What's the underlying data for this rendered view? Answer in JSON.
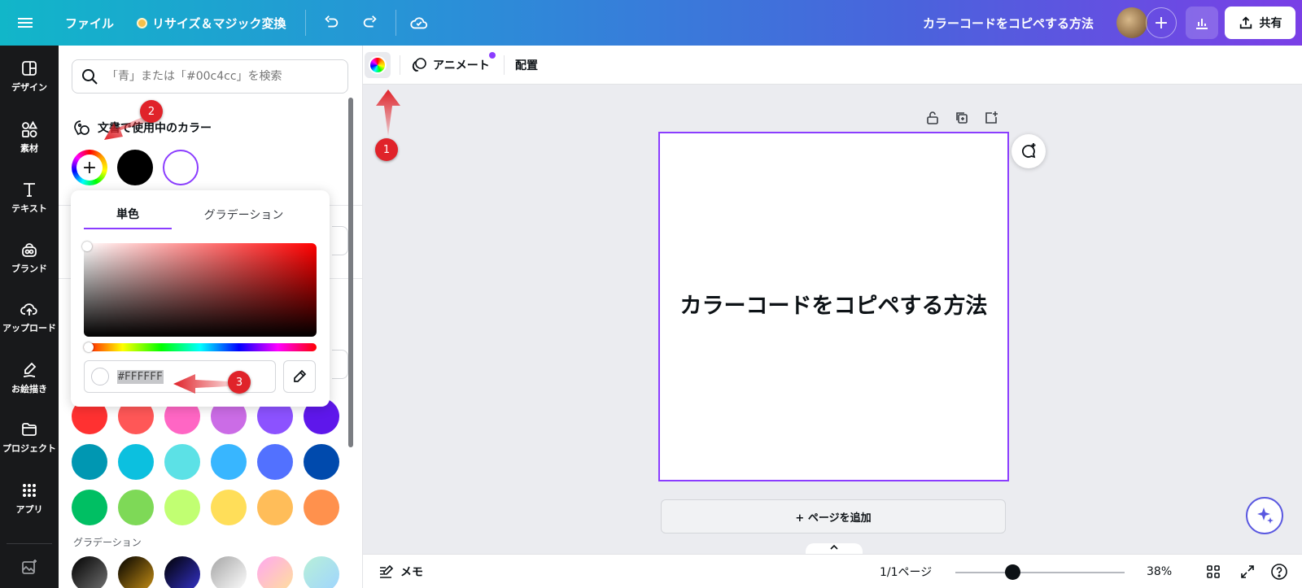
{
  "topbar": {
    "file_label": "ファイル",
    "resize_label": "リサイズ＆マジック変換",
    "doc_title": "カラーコードをコピペする方法",
    "add_label": "+",
    "share_label": "共有"
  },
  "rail": {
    "items": [
      {
        "label": "デザイン"
      },
      {
        "label": "素材"
      },
      {
        "label": "テキスト"
      },
      {
        "label": "ブランド"
      },
      {
        "label": "アップロード"
      },
      {
        "label": "お絵描き"
      },
      {
        "label": "プロジェクト"
      },
      {
        "label": "アプリ"
      }
    ]
  },
  "panel": {
    "search_placeholder": "「青」または「#00c4cc」を検索",
    "used_colors_title": "文書で使用中のカラー",
    "add_symbol": "+",
    "gradient_label": "グラデーション",
    "used_colors": [
      "#000000",
      "#FFFFFF"
    ],
    "palette": [
      "#ff3131",
      "#ff5757",
      "#ff66c4",
      "#cb6ce6",
      "#8c52ff",
      "#5e17eb",
      "#0097b2",
      "#0cc0df",
      "#5ce1e6",
      "#38b6ff",
      "#5271ff",
      "#004aad",
      "#00bf63",
      "#7ed957",
      "#c1ff72",
      "#ffde59",
      "#ffbd59",
      "#ff914d"
    ]
  },
  "picker": {
    "tab_solid": "単色",
    "tab_gradient": "グラデーション",
    "hex_value": "#FFFFFF",
    "accent": "#8b3dff"
  },
  "toolbar": {
    "animate_label": "アニメート",
    "arrange_label": "配置"
  },
  "canvas": {
    "page_text": "カラーコードをコピペする方法",
    "add_page_label": "+ ページを追加"
  },
  "bottombar": {
    "notes_label": "メモ",
    "page_indicator": "1/1ページ",
    "zoom": "38%",
    "zoom_fraction": 0.38
  },
  "markers": {
    "m1": "1",
    "m2": "2",
    "m3": "3"
  }
}
